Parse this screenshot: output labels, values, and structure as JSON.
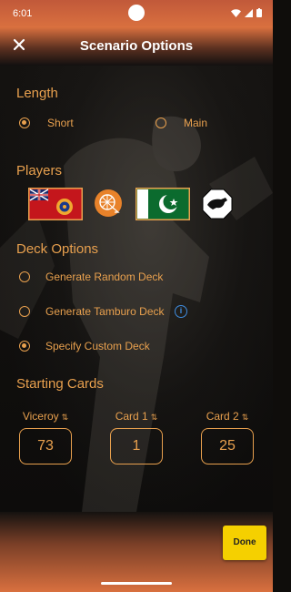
{
  "status_bar": {
    "time": "6:01"
  },
  "app_bar": {
    "title": "Scenario Options",
    "close_icon": "close-icon"
  },
  "length": {
    "title": "Length",
    "options": [
      {
        "label": "Short",
        "selected": true
      },
      {
        "label": "Main",
        "selected": false
      }
    ]
  },
  "players": {
    "title": "Players",
    "items": [
      {
        "icon": "raj-flag-icon",
        "selected": true
      },
      {
        "icon": "spinning-wheel-icon",
        "selected": false
      },
      {
        "icon": "pakistan-flag-icon",
        "selected": true
      },
      {
        "icon": "tiger-icon",
        "selected": false
      }
    ]
  },
  "deck_options": {
    "title": "Deck Options",
    "options": [
      {
        "label": "Generate Random Deck",
        "selected": false
      },
      {
        "label": "Generate Tamburo Deck",
        "selected": false,
        "info": true
      },
      {
        "label": "Specify Custom Deck",
        "selected": true
      }
    ]
  },
  "starting_cards": {
    "title": "Starting Cards",
    "columns": [
      {
        "label": "Viceroy",
        "value": "73"
      },
      {
        "label": "Card 1",
        "value": "1"
      },
      {
        "label": "Card 2",
        "value": "25"
      }
    ]
  },
  "footer": {
    "done_label": "Done"
  },
  "colors": {
    "accent": "#e8a04e",
    "done": "#f5d000",
    "info": "#3f8de0"
  }
}
